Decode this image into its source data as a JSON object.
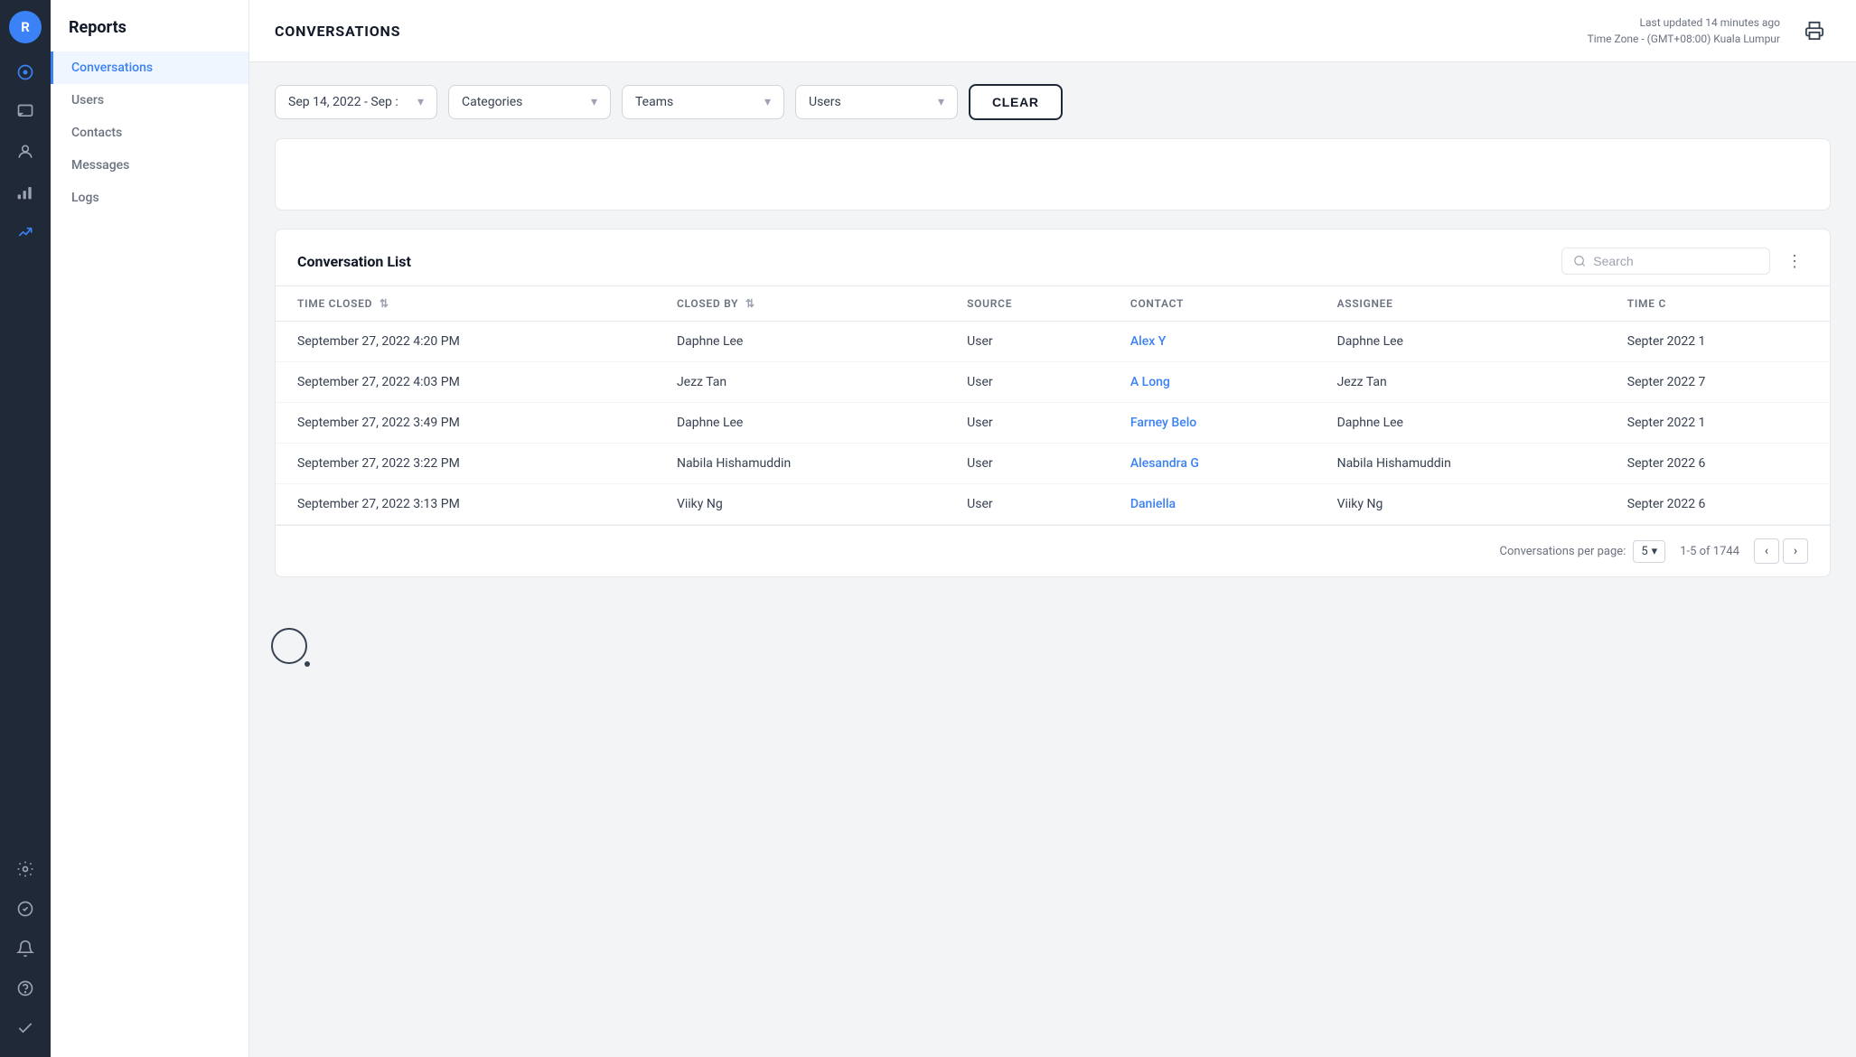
{
  "app": {
    "avatar_letter": "R"
  },
  "sidebar": {
    "title": "Reports",
    "items": [
      {
        "id": "conversations",
        "label": "Conversations",
        "active": true
      },
      {
        "id": "users",
        "label": "Users",
        "active": false
      },
      {
        "id": "contacts",
        "label": "Contacts",
        "active": false
      },
      {
        "id": "messages",
        "label": "Messages",
        "active": false
      },
      {
        "id": "logs",
        "label": "Logs",
        "active": false
      }
    ]
  },
  "header": {
    "page_title": "CONVERSATIONS",
    "last_updated": "Last updated 14 minutes ago",
    "timezone": "Time Zone - (GMT+08:00) Kuala Lumpur"
  },
  "filters": {
    "date_range": "Sep 14, 2022 - Sep :",
    "categories_placeholder": "Categories",
    "teams_placeholder": "Teams",
    "users_placeholder": "Users",
    "clear_label": "CLEAR"
  },
  "conversation_list": {
    "title": "Conversation List",
    "search_placeholder": "Search",
    "columns": [
      {
        "id": "time_closed",
        "label": "TIME CLOSED",
        "sortable": true
      },
      {
        "id": "closed_by",
        "label": "CLOSED BY",
        "sortable": true
      },
      {
        "id": "source",
        "label": "SOURCE",
        "sortable": false
      },
      {
        "id": "contact",
        "label": "CONTACT",
        "sortable": false
      },
      {
        "id": "assignee",
        "label": "ASSIGNEE",
        "sortable": false
      },
      {
        "id": "time_created",
        "label": "TIME C",
        "sortable": false
      }
    ],
    "rows": [
      {
        "time_closed": "September 27, 2022 4:20 PM",
        "closed_by": "Daphne Lee",
        "source": "User",
        "contact": "Alex Y",
        "assignee": "Daphne Lee",
        "time_created": "Septer 2022 1"
      },
      {
        "time_closed": "September 27, 2022 4:03 PM",
        "closed_by": "Jezz Tan",
        "source": "User",
        "contact": "A Long",
        "assignee": "Jezz Tan",
        "time_created": "Septer 2022 7"
      },
      {
        "time_closed": "September 27, 2022 3:49 PM",
        "closed_by": "Daphne Lee",
        "source": "User",
        "contact": "Farney Belo",
        "assignee": "Daphne Lee",
        "time_created": "Septer 2022 1"
      },
      {
        "time_closed": "September 27, 2022 3:22 PM",
        "closed_by": "Nabila Hishamuddin",
        "source": "User",
        "contact": "Alesandra G",
        "assignee": "Nabila Hishamuddin",
        "time_created": "Septer 2022 6"
      },
      {
        "time_closed": "September 27, 2022 3:13 PM",
        "closed_by": "Viiky Ng",
        "source": "User",
        "contact": "Daniella",
        "assignee": "Viiky Ng",
        "time_created": "Septer 2022 6"
      }
    ],
    "pagination": {
      "per_page_label": "Conversations per page:",
      "per_page_value": "5",
      "page_info": "1-5 of 1744"
    }
  },
  "icons": {
    "dashboard": "⊙",
    "chat": "💬",
    "contacts": "👤",
    "signal": "📶",
    "chart": "📊",
    "settings": "⚙",
    "badge": "✔",
    "bell": "🔔",
    "help": "?",
    "check": "✔"
  }
}
